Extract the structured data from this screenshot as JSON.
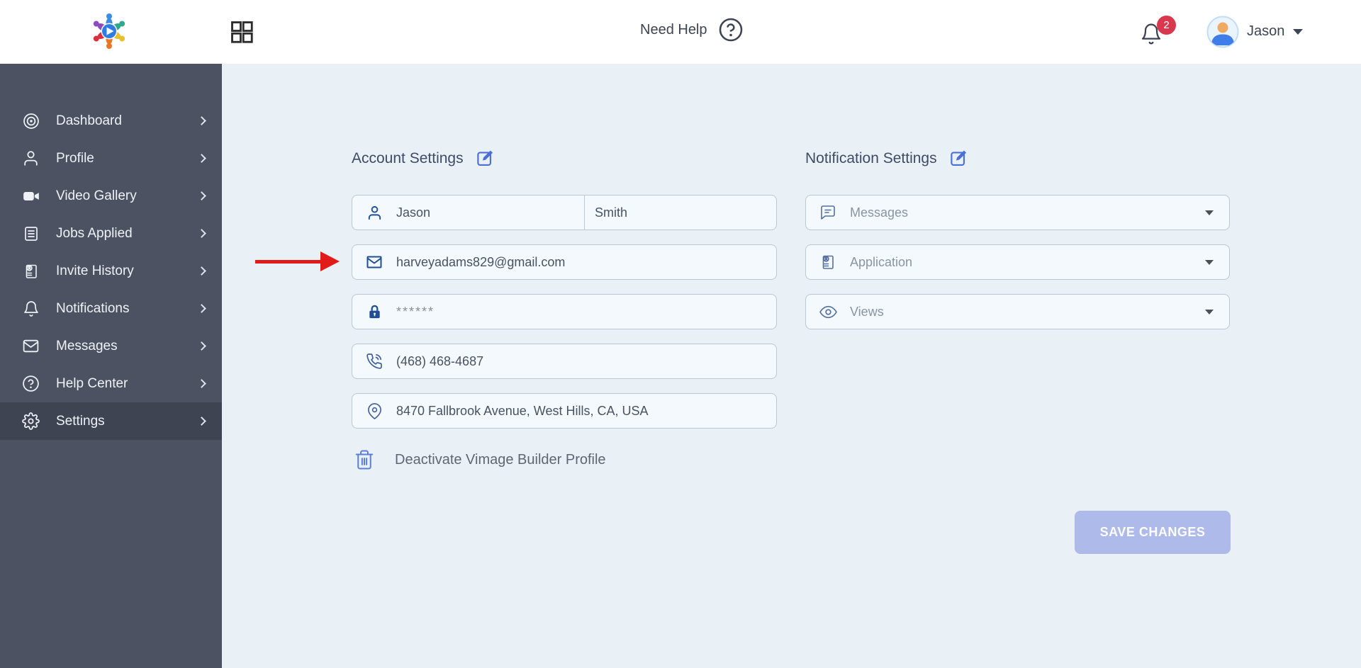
{
  "header": {
    "need_help_label": "Need Help",
    "notification_count": "2",
    "user_name": "Jason"
  },
  "sidebar": {
    "items": [
      {
        "label": "Dashboard"
      },
      {
        "label": "Profile"
      },
      {
        "label": "Video Gallery"
      },
      {
        "label": "Jobs Applied"
      },
      {
        "label": "Invite History"
      },
      {
        "label": "Notifications"
      },
      {
        "label": "Messages"
      },
      {
        "label": "Help Center"
      },
      {
        "label": "Settings"
      }
    ],
    "active_item": "Settings"
  },
  "account_settings": {
    "title": "Account Settings",
    "fields": {
      "first_name": {
        "value": "Jason"
      },
      "last_name": {
        "value": "Smith"
      },
      "email": {
        "value": "harveyadams829@gmail.com"
      },
      "password": {
        "value": "******"
      },
      "phone": {
        "value": "(468) 468-4687"
      },
      "address": {
        "value": "8470 Fallbrook Avenue, West Hills, CA, USA"
      }
    },
    "deactivate_label": "Deactivate Vimage Builder Profile"
  },
  "notification_settings": {
    "title": "Notification Settings",
    "dropdowns": [
      {
        "label": "Messages"
      },
      {
        "label": "Application"
      },
      {
        "label": "Views"
      }
    ]
  },
  "actions": {
    "save_label": "SAVE CHANGES"
  },
  "colors": {
    "page_bg": "#eaf1f6",
    "sidebar_bg": "#4c5261",
    "sidebar_active_bg": "#3e4452",
    "accent_blue": "#4a6fd8",
    "icon_dark_blue": "#1f4e96",
    "badge_red": "#d8384e",
    "save_button_bg": "#adbaea",
    "arrow_red": "#e11a1a"
  }
}
